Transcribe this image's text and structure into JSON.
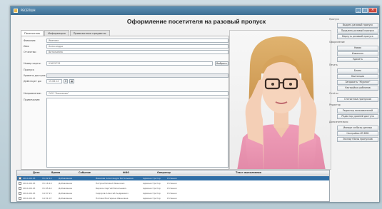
{
  "window": {
    "title": "РЕСЕПШН"
  },
  "header": {
    "title": "Оформление посетителя на разовый пропуск"
  },
  "tabs": [
    {
      "label": "Посетитель"
    },
    {
      "label": "Информация"
    },
    {
      "label": "Привязанные предметы"
    }
  ],
  "form": {
    "surname": {
      "label": "Фамилия:",
      "value": "Иванова"
    },
    "name": {
      "label": "Имя:",
      "value": "Александра"
    },
    "patronymic": {
      "label": "Отчество:",
      "value": "Витальевна"
    },
    "card": {
      "label": "Номер карты:",
      "value": "01625733",
      "button": "Выбрать"
    },
    "access_label": "Пропуск",
    "access_level": {
      "label": "Уровень доступа:"
    },
    "valid_until": {
      "label": "Действует до:",
      "value": "15.08.14"
    },
    "purpose": {
      "label": "Направление:",
      "value": "ООО \"Компания\""
    },
    "note": {
      "label": "Примечание:"
    }
  },
  "sidebar": {
    "groups": [
      {
        "title": "Пропуск",
        "buttons": [
          "Выдать разовый пропуск",
          "Продлить разовый пропуск",
          "Вернуть разовый пропуск"
        ]
      },
      {
        "title": "Оформление",
        "buttons": [
          "Новая",
          "Изменить",
          "Удалить"
        ]
      },
      {
        "title": "Печать",
        "buttons": [
          "Бланк",
          "Квитанция",
          "Запросить \"Журнал\"",
          "Настройка шаблонов"
        ]
      },
      {
        "title": "Отчёты",
        "buttons": [
          "Статистика пропусков"
        ]
      },
      {
        "title": "Редактор",
        "buttons": [
          "Редактор пользователей",
          "Редактор уровней доступа"
        ]
      },
      {
        "title": "Дополнительно",
        "buttons": [
          "Импорт из базы данных",
          "Настройки ИЗ ВЭБ",
          "Экспорт базы пропусков"
        ]
      }
    ]
  },
  "journal": {
    "columns": [
      "Дата",
      "Время",
      "Событие",
      "ФИО",
      "Оператор",
      "Текст выполнения"
    ],
    "rows": [
      {
        "date": "2014-08-15",
        "time": "15:22:14",
        "event": "Добавление",
        "fio": "Иванова Александра Витальевна",
        "operator": "Администратор",
        "text": "Успешно"
      },
      {
        "date": "2014-08-15",
        "time": "15:16:10",
        "event": "Добавление",
        "fio": "Петров Михаил Иванович",
        "operator": "Администратор",
        "text": "Успешно"
      },
      {
        "date": "2014-08-15",
        "time": "15:05:44",
        "event": "Добавление",
        "fio": "Беркин Сергей Васильевич",
        "operator": "Администратор",
        "text": "Успешно"
      },
      {
        "date": "2014-08-15",
        "time": "14:57:21",
        "event": "Добавление",
        "fio": "Сидоров Алексей Андреевич",
        "operator": "Администратор",
        "text": "Успешно"
      },
      {
        "date": "2014-08-15",
        "time": "14:51:07",
        "event": "Добавление",
        "fio": "Попова Екатерина Ивановна",
        "operator": "Администратор",
        "text": "Успешно"
      }
    ]
  },
  "colors": {
    "accent": "#2f6ea6",
    "titlebar": "#3d6e93"
  }
}
